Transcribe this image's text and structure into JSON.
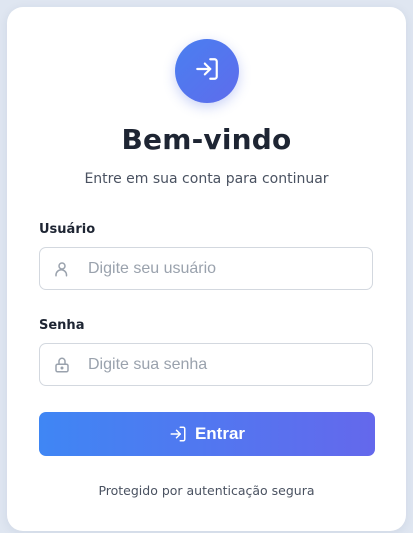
{
  "login": {
    "title": "Bem-vindo",
    "subtitle": "Entre em sua conta para continuar",
    "username": {
      "label": "Usuário",
      "placeholder": "Digite seu usuário",
      "value": "",
      "icon": "user-icon"
    },
    "password": {
      "label": "Senha",
      "placeholder": "Digite sua senha",
      "value": "",
      "icon": "lock-icon"
    },
    "submit": {
      "label": "Entrar",
      "icon": "login-icon"
    },
    "footer": "Protegido por autenticação segura",
    "logo_icon": "login-icon"
  },
  "colors": {
    "accent_start": "#3f86f4",
    "accent_end": "#6468ec",
    "background": "#dfe6f1",
    "card": "#ffffff",
    "text": "#1e2533"
  }
}
